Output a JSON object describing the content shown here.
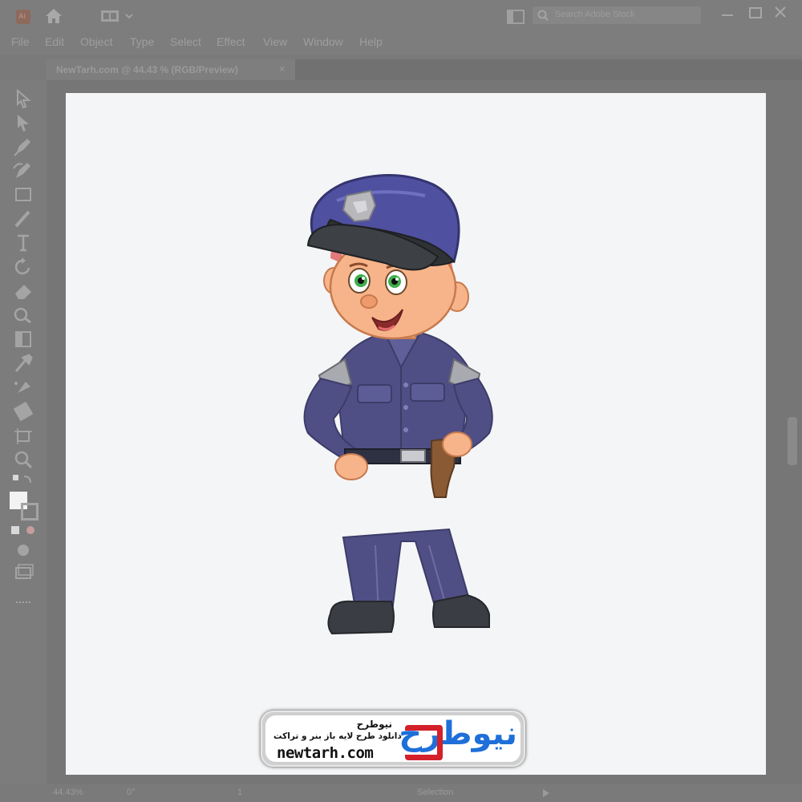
{
  "app": {
    "logo_text": "Ai",
    "search_placeholder": "Search Adobe Stock"
  },
  "menu": [
    "File",
    "Edit",
    "Object",
    "Type",
    "Select",
    "Effect",
    "View",
    "Window",
    "Help"
  ],
  "document_tab": {
    "title": "NewTarh.com @ 44.43 % (RGB/Preview)",
    "close": "×"
  },
  "status": {
    "zoom": "44.43%",
    "rotation": "0°",
    "artboard": "1",
    "mode": "Selection"
  },
  "watermark": {
    "logo_text": "نیوطرح",
    "title": "نیوطرح",
    "subtitle": "دانلود طرح لایه باز بنر و تراکت",
    "url": "newtarh.com",
    "colors": {
      "logo_blue": "#1e6fd9",
      "logo_red": "#d3202a",
      "text": "#111111"
    }
  },
  "illustration": {
    "subject": "police-officer-cartoon",
    "colors": {
      "uniform": "#4f4f86",
      "skin": "#f7b48a",
      "shoes": "#3a3d44",
      "holster": "#8a5a34",
      "badge": "#b8b8bc"
    }
  }
}
